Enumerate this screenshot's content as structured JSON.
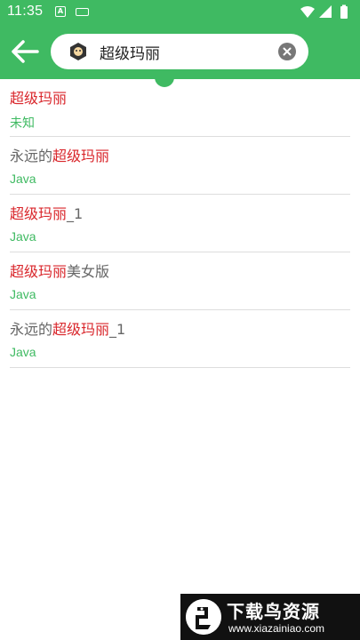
{
  "status_bar": {
    "time": "11:35",
    "app_icon_letter": "A",
    "icons": [
      "app-notification-icon",
      "keyboard-icon",
      "wifi-icon",
      "signal-icon",
      "battery-icon"
    ]
  },
  "header": {
    "background": "#3fba62",
    "search": {
      "value": "超级玛丽",
      "placeholder": ""
    }
  },
  "results": [
    {
      "prefix": "",
      "highlight": "超级玛丽",
      "suffix": "",
      "category": "未知"
    },
    {
      "prefix": "永远的",
      "highlight": "超级玛丽",
      "suffix": "",
      "category": "Java"
    },
    {
      "prefix": "",
      "highlight": "超级玛丽",
      "suffix": "_1",
      "category": "Java"
    },
    {
      "prefix": "",
      "highlight": "超级玛丽",
      "suffix": "美女版",
      "category": "Java"
    },
    {
      "prefix": "永远的",
      "highlight": "超级玛丽",
      "suffix": "_1",
      "category": "Java"
    }
  ],
  "colors": {
    "accent": "#3fba62",
    "highlight": "#d9262b",
    "text": "#666666"
  },
  "watermark": {
    "title": "下载鸟资源",
    "url": "www.xiazainiao.com"
  }
}
